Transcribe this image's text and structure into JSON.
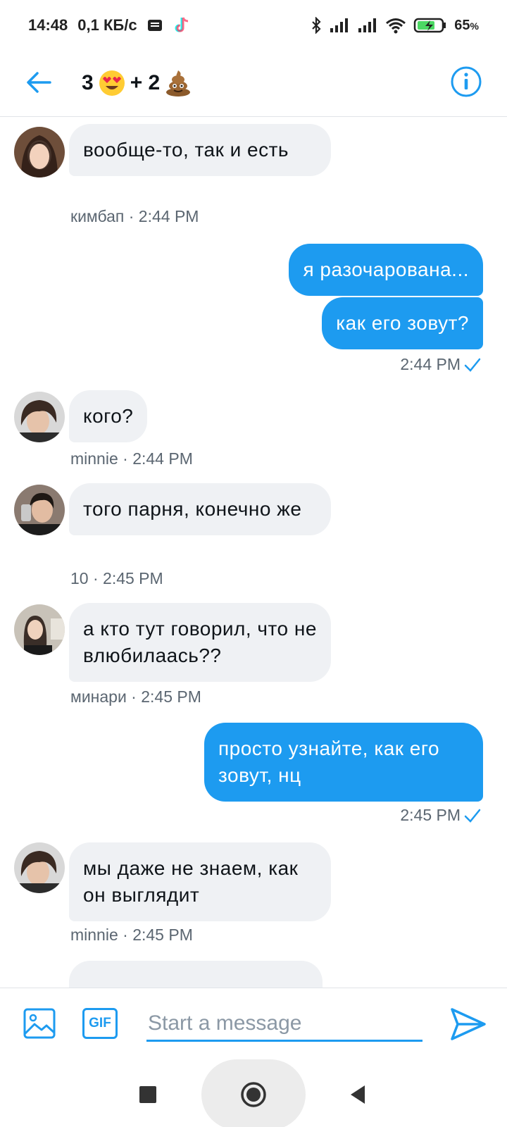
{
  "status_bar": {
    "time": "14:48",
    "speed": "0,1 КБ/с",
    "battery": "65",
    "battery_unit": "%"
  },
  "header": {
    "title_count_a": "3",
    "title_count_b": "+ 2",
    "emoji_a": "heart-eyes-emoji",
    "emoji_b": "pile-of-poo-emoji"
  },
  "messages": [
    {
      "direction": "in",
      "text": "вообще-то, так и есть",
      "sender": "кимбап",
      "time": "2:44 PM",
      "meta": "кимбап · 2:44 PM"
    },
    {
      "direction": "out",
      "text": "я разочарована..."
    },
    {
      "direction": "out",
      "text": "как его зовут?",
      "meta": "2:44 PM"
    },
    {
      "direction": "in",
      "text": "кого?",
      "sender": "minnie",
      "time": "2:44 PM",
      "meta": "minnie · 2:44 PM"
    },
    {
      "direction": "in",
      "text": "того парня, конечно же",
      "sender": "10",
      "time": "2:45 PM",
      "meta": "10 · 2:45 PM"
    },
    {
      "direction": "in",
      "text": "а кто тут говорил, что не влюбилаась??",
      "sender": "минари",
      "time": "2:45 PM",
      "meta": "минари · 2:45 PM"
    },
    {
      "direction": "out",
      "text": "просто узнайте, как его зовут, нц",
      "meta": "2:45 PM"
    },
    {
      "direction": "in",
      "text": "мы даже не знаем, как он выглядит",
      "sender": "minnie",
      "time": "2:45 PM",
      "meta": "minnie · 2:45 PM"
    }
  ],
  "composer": {
    "placeholder": "Start a message",
    "gif_label": "GIF"
  },
  "colors": {
    "accent": "#1d9bf0",
    "bubble_in": "#eff1f4",
    "meta_text": "#5b6671"
  }
}
